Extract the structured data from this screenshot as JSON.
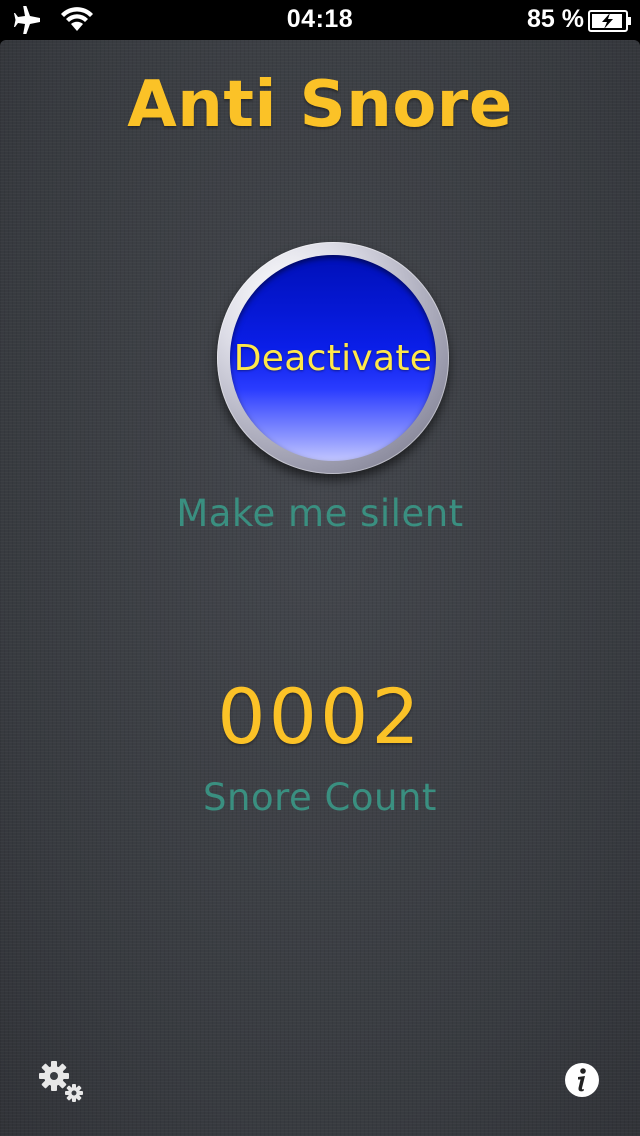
{
  "status_bar": {
    "time": "04:18",
    "battery_percent": "85 %",
    "icons": [
      "airplane-icon",
      "wifi-icon",
      "battery-charging-icon"
    ]
  },
  "app": {
    "title": "Anti Snore",
    "button_label": "Deactivate",
    "button_caption": "Make me silent",
    "snore_count": "0002",
    "snore_count_label": "Snore Count"
  },
  "toolbar": {
    "left_icon": "settings-gears-icon",
    "right_icon": "info-icon"
  },
  "colors": {
    "title_yellow": "#fbc227",
    "caption_teal": "#3a8f80",
    "button_blue": "#0a1ee8",
    "button_text": "#ffe84a",
    "background": "#3a3d42"
  }
}
